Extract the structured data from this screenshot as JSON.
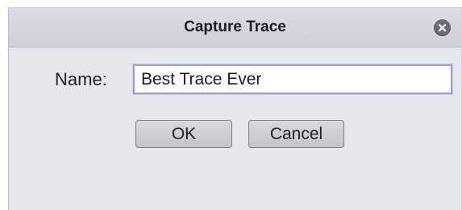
{
  "dialog": {
    "title": "Capture Trace",
    "name_label": "Name:",
    "name_value": "Best Trace Ever",
    "ok_label": "OK",
    "cancel_label": "Cancel",
    "close_icon": "close-icon"
  }
}
